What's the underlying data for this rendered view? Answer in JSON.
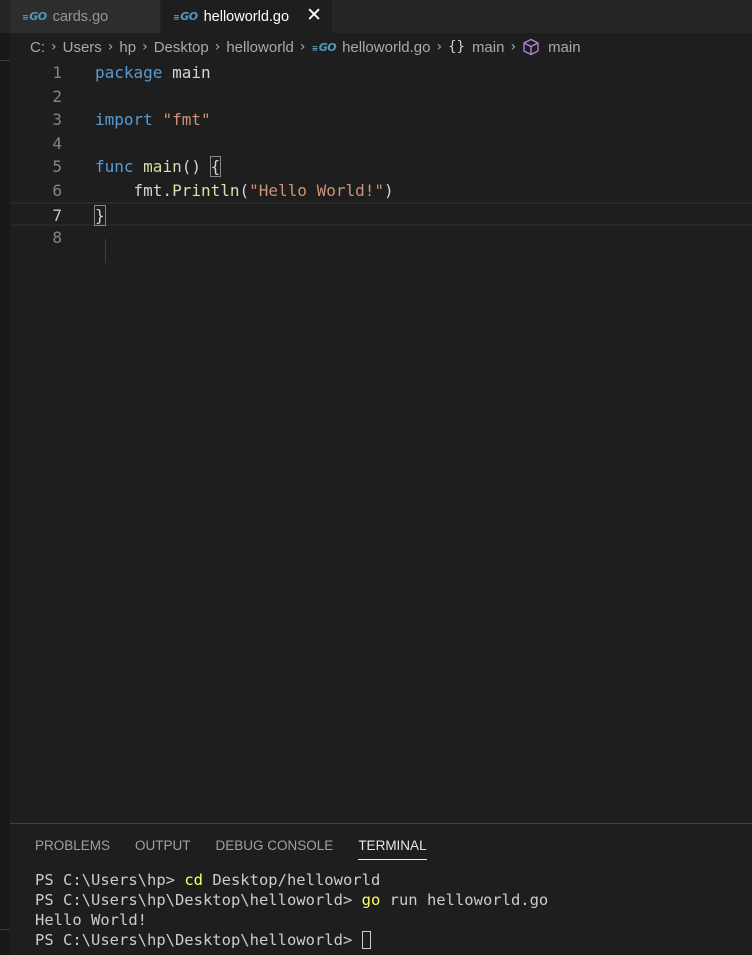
{
  "tabs": [
    {
      "label": "cards.go",
      "icon": "go-file-icon",
      "active": false
    },
    {
      "label": "helloworld.go",
      "icon": "go-file-icon",
      "active": true,
      "close": "✕"
    }
  ],
  "breadcrumb": {
    "drive": "C:",
    "users": "Users",
    "user": "hp",
    "desktop": "Desktop",
    "folder": "helloworld",
    "file": "helloworld.go",
    "package": "main",
    "function": "main"
  },
  "editor": {
    "current_line": 7,
    "lines": [
      {
        "n": "1",
        "tokens": [
          {
            "t": "package",
            "c": "kw"
          },
          {
            "t": " main",
            "c": "id"
          }
        ]
      },
      {
        "n": "2",
        "tokens": []
      },
      {
        "n": "3",
        "tokens": [
          {
            "t": "import",
            "c": "kw"
          },
          {
            "t": " ",
            "c": "id"
          },
          {
            "t": "\"fmt\"",
            "c": "str"
          }
        ]
      },
      {
        "n": "4",
        "tokens": []
      },
      {
        "n": "5",
        "tokens": [
          {
            "t": "func",
            "c": "kw"
          },
          {
            "t": " ",
            "c": "id"
          },
          {
            "t": "main",
            "c": "fn"
          },
          {
            "t": "() ",
            "c": "id"
          },
          {
            "t": "{",
            "c": "id bracket-box"
          }
        ]
      },
      {
        "n": "6",
        "tokens": [
          {
            "t": "    fmt.",
            "c": "id"
          },
          {
            "t": "Println",
            "c": "fn"
          },
          {
            "t": "(",
            "c": "id"
          },
          {
            "t": "\"Hello World!\"",
            "c": "str"
          },
          {
            "t": ")",
            "c": "id"
          }
        ]
      },
      {
        "n": "7",
        "tokens": [
          {
            "t": "}",
            "c": "id bracket-box"
          }
        ]
      },
      {
        "n": "8",
        "tokens": []
      }
    ]
  },
  "panel": {
    "tabs": [
      "PROBLEMS",
      "OUTPUT",
      "DEBUG CONSOLE",
      "TERMINAL"
    ],
    "active_tab": "TERMINAL"
  },
  "terminal": {
    "line1_prompt": "PS C:\\Users\\hp> ",
    "line1_cmd": "cd",
    "line1_args": " Desktop/helloworld",
    "line2_prompt": "PS C:\\Users\\hp\\Desktop\\helloworld> ",
    "line2_cmd": "go",
    "line2_args": " run helloworld.go",
    "line3_output": "Hello World!",
    "line4_prompt": "PS C:\\Users\\hp\\Desktop\\helloworld> "
  },
  "colors": {
    "keyword": "#569cd6",
    "string": "#ce9178",
    "function": "#dcdcaa",
    "go_icon": "#519aba",
    "cube_icon": "#b180d7",
    "terminal_cmd": "#ffff66"
  }
}
